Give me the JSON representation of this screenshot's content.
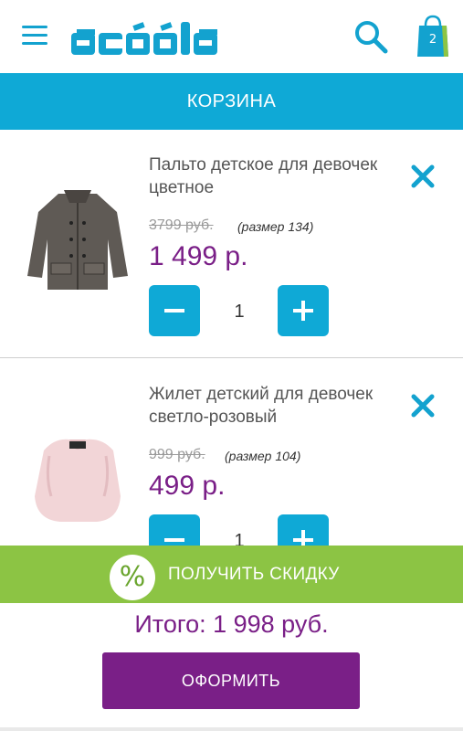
{
  "header": {
    "logo_alt": "acoola",
    "cart_count": "2",
    "icons": [
      "menu-icon",
      "search-icon",
      "shopping-bag-icon"
    ]
  },
  "page": {
    "title": "КОРЗИНА"
  },
  "cart": {
    "items": [
      {
        "name": "Пальто детское для девочек цветное",
        "old_price": "3799 руб.",
        "size": "(размер 134)",
        "price": "1 499 р.",
        "quantity": "1"
      },
      {
        "name": "Жилет детский для девочек светло-розовый",
        "old_price": "999 руб.",
        "size": "(размер 104)",
        "price": "499 р.",
        "quantity": "1"
      }
    ]
  },
  "discount": {
    "symbol": "%",
    "label": "ПОЛУЧИТЬ СКИДКУ"
  },
  "summary": {
    "total": "Итого: 1 998 руб.",
    "checkout_label": "ОФОРМИТЬ"
  },
  "colors": {
    "accent_blue": "#0fa9d6",
    "price_purple": "#7a1f87",
    "discount_green": "#8cc444",
    "bag_green": "#8cc444"
  }
}
